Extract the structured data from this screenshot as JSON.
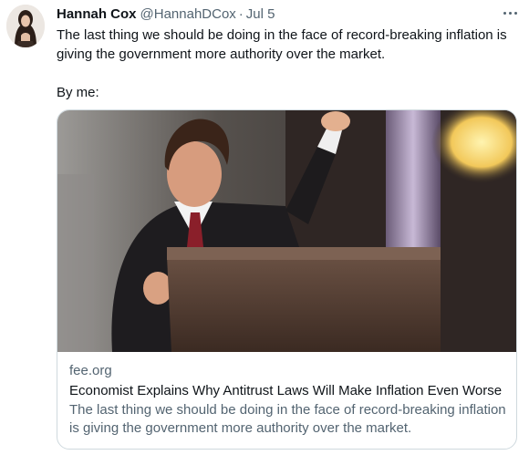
{
  "tweet": {
    "author": {
      "display_name": "Hannah Cox",
      "handle": "@HannahDCox",
      "separator": "·",
      "date": "Jul 5",
      "avatar_icon": "profile-avatar"
    },
    "more_icon": "more-horizontal-icon",
    "text_line_1": "The last thing we should be doing in the face of record-breaking inflation is giving the government more authority over the market.",
    "text_line_2": "By me:",
    "card": {
      "image_icon": "article-photo-speaker-at-podium",
      "domain": "fee.org",
      "title": "Economist Explains Why Antitrust Laws Will Make Inflation Even Worse",
      "description": "The last thing we should be doing in the face of record-breaking inflation is giving the government more authority over the market."
    }
  }
}
